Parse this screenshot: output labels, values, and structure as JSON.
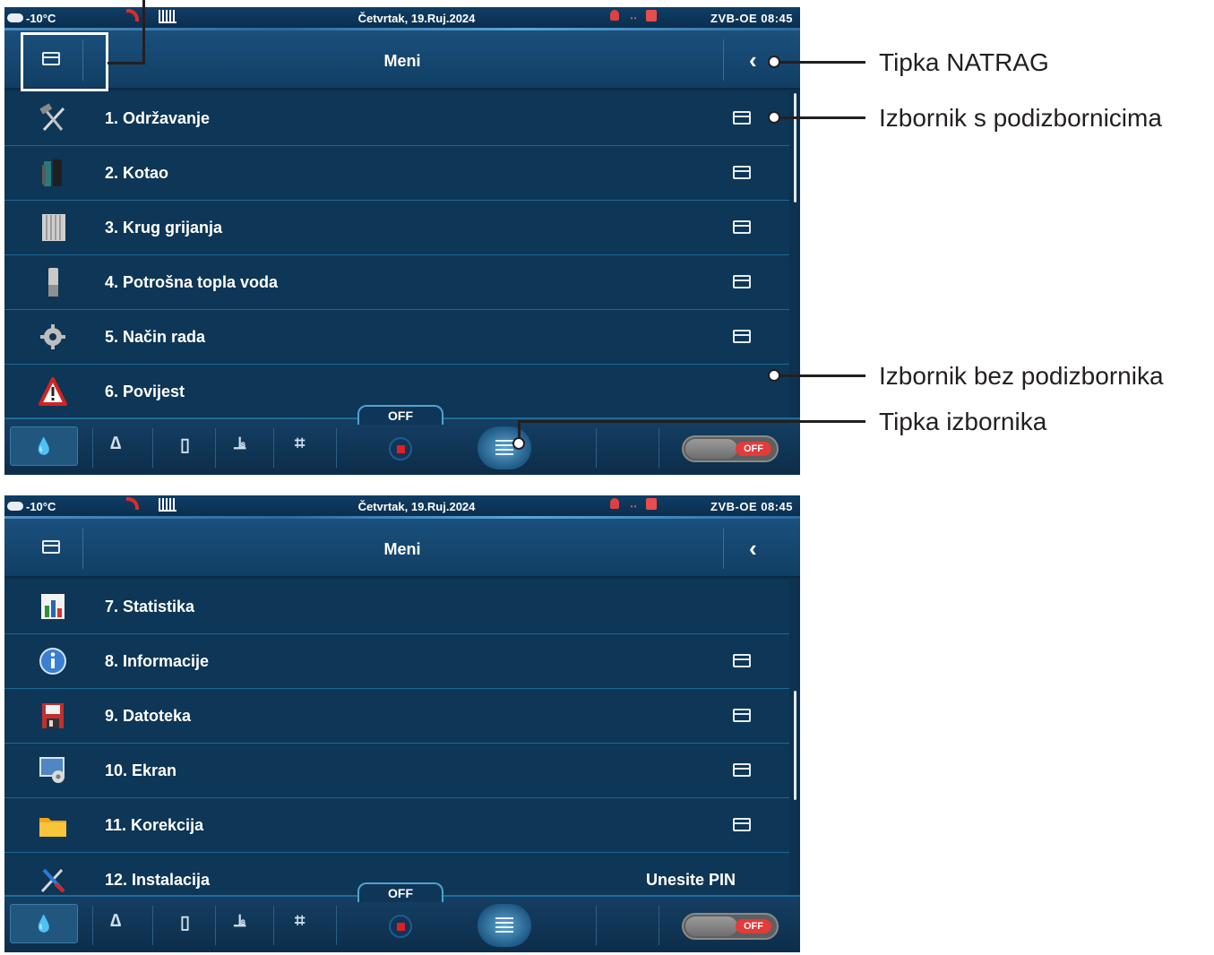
{
  "status_bar": {
    "temperature": "-10°C",
    "date": "Četvrtak, 19.Ruj.2024",
    "right": "ZVB-OE  08:45"
  },
  "header": {
    "title": "Meni",
    "back_icon": "chevron-left-icon",
    "folder_icon": "folder-icon"
  },
  "menu_page1": [
    {
      "label": "1.  Održavanje",
      "icon": "maintenance-icon",
      "submenu": true
    },
    {
      "label": "2.  Kotao",
      "icon": "boiler-icon",
      "submenu": true
    },
    {
      "label": "3.  Krug grijanja",
      "icon": "radiator-icon",
      "submenu": true
    },
    {
      "label": "4.  Potrošna topla voda",
      "icon": "water-tank-icon",
      "submenu": true
    },
    {
      "label": "5.  Način rada",
      "icon": "gear-icon",
      "submenu": true
    },
    {
      "label": "6.  Povijest",
      "icon": "warning-icon",
      "submenu": false
    }
  ],
  "menu_page2": [
    {
      "label": "7.  Statistika",
      "icon": "statistics-icon",
      "submenu": false
    },
    {
      "label": "8.  Informacije",
      "icon": "info-icon",
      "submenu": true
    },
    {
      "label": "9.  Datoteka",
      "icon": "floppy-disk-icon",
      "submenu": true
    },
    {
      "label": "10. Ekran",
      "icon": "screen-settings-icon",
      "submenu": true
    },
    {
      "label": "11. Korekcija",
      "icon": "folder-yellow-icon",
      "submenu": true
    },
    {
      "label": "12. Instalacija",
      "icon": "tools-icon",
      "submenu": false,
      "right_text": "Unesite PIN"
    }
  ],
  "bottom_bar": {
    "off_tab": "OFF",
    "toggle_label": "OFF",
    "mode_icon": "mode-all-icon"
  },
  "annotations": {
    "back_button": "Tipka NATRAG",
    "with_submenus": "Izbornik s podizbornicima",
    "without_submenu": "Izbornik bez podizbornika",
    "menu_button": "Tipka izbornika"
  },
  "colors": {
    "panel": "#0d3150",
    "row": "#0e3656",
    "row_divider": "#1c6a93",
    "stop_red": "#e01f1f",
    "annotation_text": "#231f20"
  }
}
